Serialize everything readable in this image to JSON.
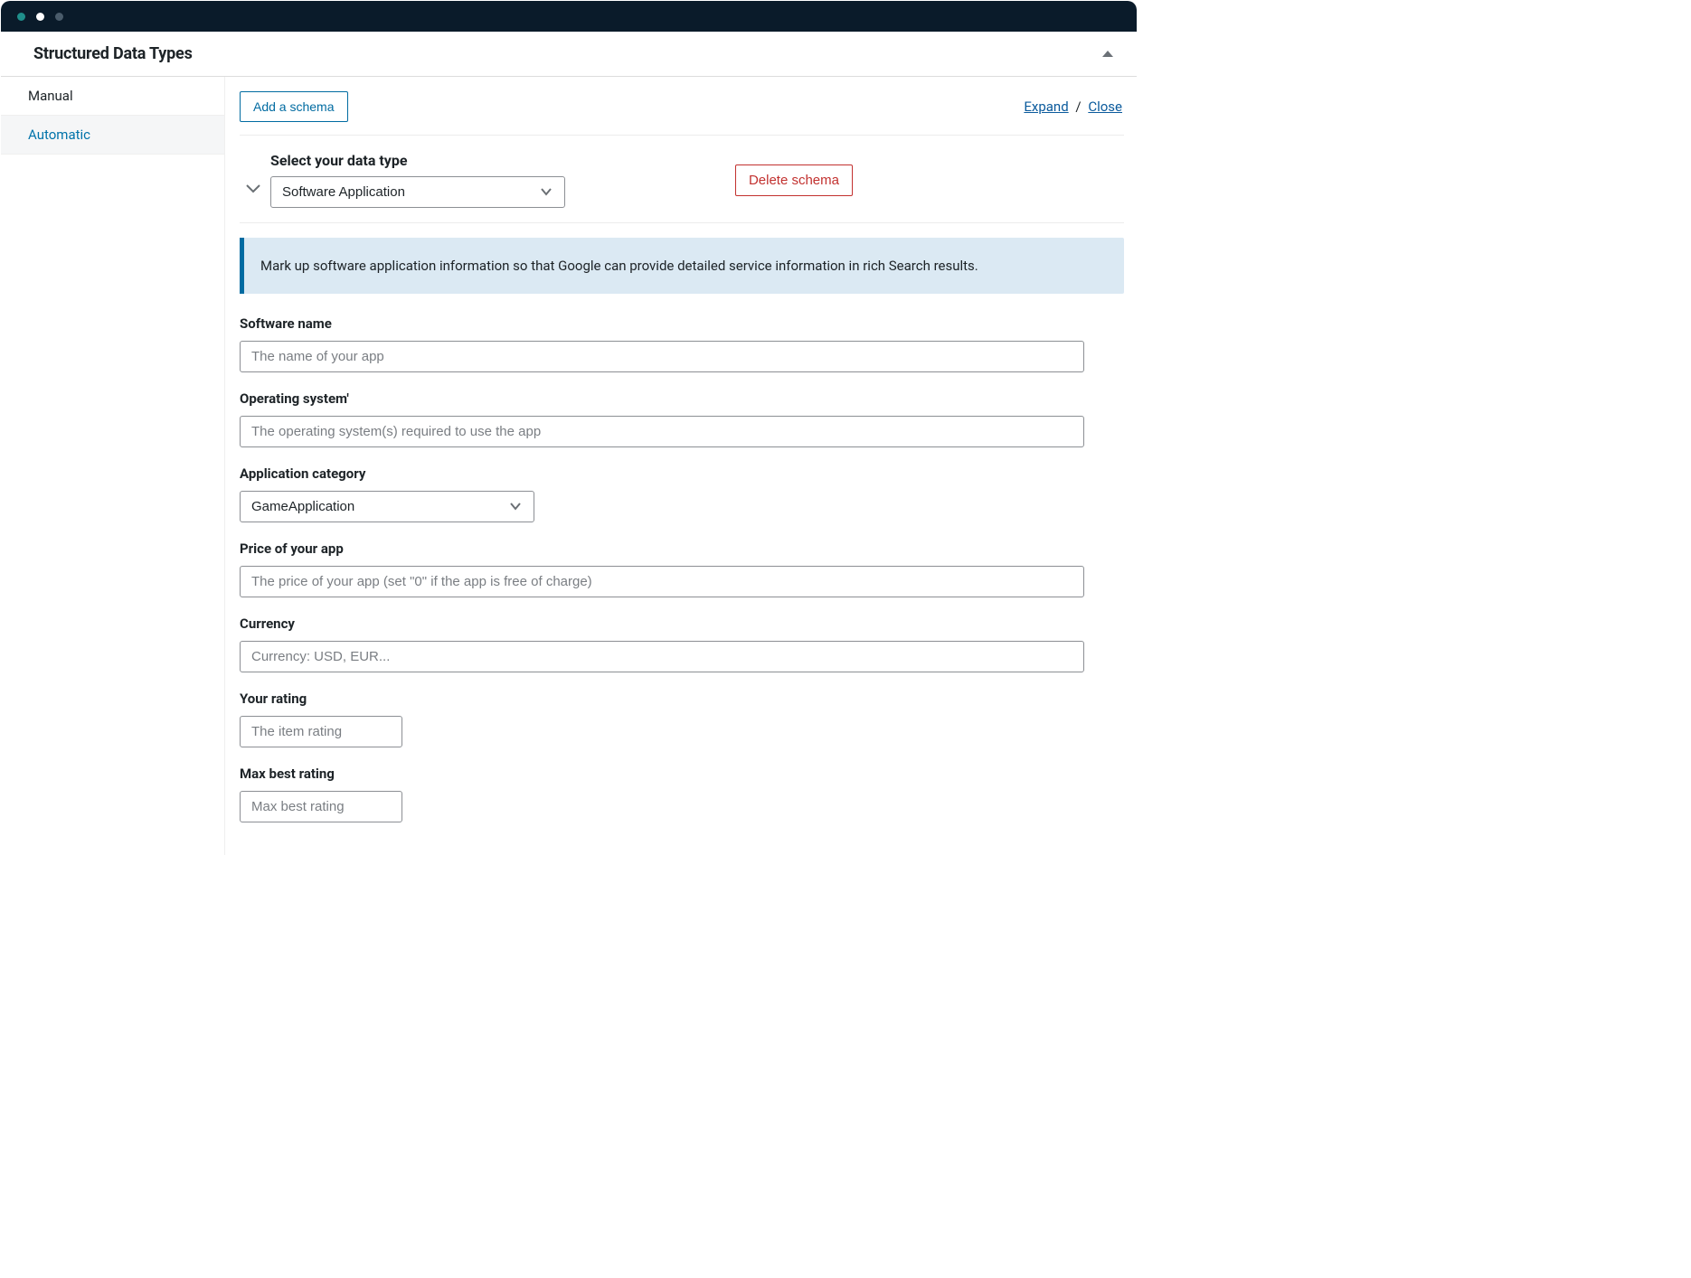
{
  "header": {
    "title": "Structured Data Types"
  },
  "sidebar": {
    "items": [
      {
        "label": "Manual",
        "active": true
      },
      {
        "label": "Automatic",
        "active": false
      }
    ]
  },
  "toolbar": {
    "add_schema_label": "Add a schema",
    "expand_label": "Expand",
    "close_label": "Close",
    "separator": "/"
  },
  "schema": {
    "select_label": "Select your data type",
    "data_type_value": "Software Application",
    "delete_label": "Delete schema",
    "info_text": "Mark up software application information so that Google can provide detailed service information in rich Search results."
  },
  "fields": {
    "software_name": {
      "label": "Software name",
      "placeholder": "The name of your app",
      "value": ""
    },
    "operating_system": {
      "label": "Operating system'",
      "placeholder": "The operating system(s) required to use the app",
      "value": ""
    },
    "application_category": {
      "label": "Application category",
      "value": "GameApplication"
    },
    "price": {
      "label": "Price of your app",
      "placeholder": "The price of your app (set \"0\" if the app is free of charge)",
      "value": ""
    },
    "currency": {
      "label": "Currency",
      "placeholder": "Currency: USD, EUR...",
      "value": ""
    },
    "your_rating": {
      "label": "Your rating",
      "placeholder": "The item rating",
      "value": ""
    },
    "max_best_rating": {
      "label": "Max best rating",
      "placeholder": "Max best rating",
      "value": ""
    }
  }
}
